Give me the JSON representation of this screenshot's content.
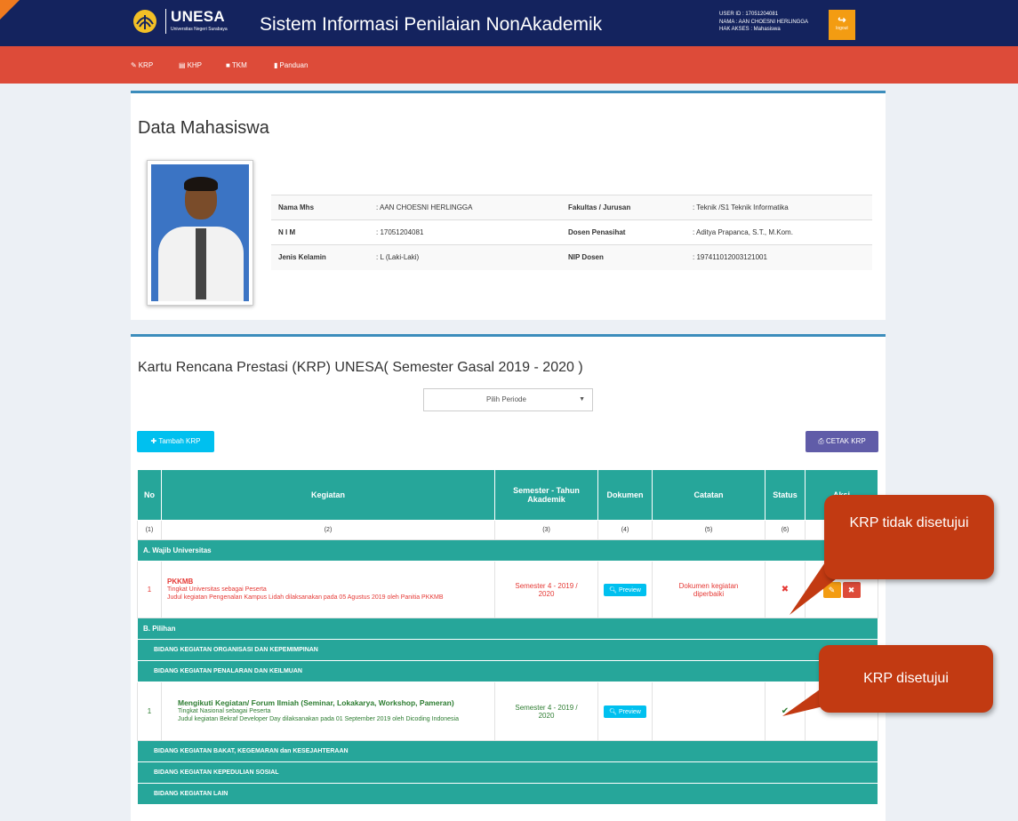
{
  "header": {
    "logo_text": "UNESA",
    "logo_subtext": "Universitas Negeri Surabaya",
    "app_title": "Sistem Informasi Penilaian NonAkademik",
    "user_id": "USER ID : 17051204081",
    "user_name": "NAMA : AAN CHOESNI HERLINGGA",
    "user_access": "HAK AKSES : Mahasiswa",
    "logout_label": "logout"
  },
  "nav": {
    "items": [
      {
        "label": "KRP",
        "icon": "edit-icon"
      },
      {
        "label": "KHP",
        "icon": "file-icon"
      },
      {
        "label": "TKM",
        "icon": "file-text-icon"
      },
      {
        "label": "Panduan",
        "icon": "book-icon"
      }
    ]
  },
  "student": {
    "section_title": "Data Mahasiswa",
    "fields": [
      {
        "label": "Nama Mhs",
        "value": ": AAN CHOESNI HERLINGGA",
        "label2": "Fakultas / Jurusan",
        "value2": ": Teknik /S1 Teknik Informatika"
      },
      {
        "label": "N I M",
        "value": ": 17051204081",
        "label2": "Dosen Penasihat",
        "value2": ": Aditya Prapanca, S.T., M.Kom."
      },
      {
        "label": "Jenis Kelamin",
        "value": ": L (Laki-Laki)",
        "label2": "NIP Dosen",
        "value2": ": 197411012003121001"
      }
    ]
  },
  "krp": {
    "title": "Kartu Rencana Prestasi (KRP) UNESA( Semester Gasal 2019 - 2020 )",
    "periode_placeholder": "Pilih Periode",
    "add_label": "Tambah KRP",
    "print_label": "CETAK KRP",
    "columns": [
      "No",
      "Kegiatan",
      "Semester - Tahun Akademik",
      "Dokumen",
      "Catatan",
      "Status",
      "Aksi"
    ],
    "column_numbers": [
      "(1)",
      "(2)",
      "(3)",
      "(4)",
      "(5)",
      "(6)",
      ""
    ],
    "group_a": "A. Wajib Universitas",
    "row1": {
      "no": "1",
      "title": "PKKMB",
      "level": "Tingkat Universitas sebagai Peserta",
      "desc": "Judul kegiatan Pengenalan Kampus Lidah dilaksanakan pada 05 Agustus 2019 oleh Panitia PKKMB",
      "semester": "Semester 4 - 2019 / 2020",
      "doc_button": "Preview",
      "note": "Dokumen kegiatan diperbaiki",
      "status": "✖"
    },
    "group_b": "B. Pilihan",
    "sub1": "BIDANG KEGIATAN ORGANISASI DAN KEPEMIMPINAN",
    "sub2": "BIDANG KEGIATAN PENALARAN DAN KEILMUAN",
    "row2": {
      "no": "1",
      "title": "Mengikuti Kegiatan/ Forum Ilmiah (Seminar, Lokakarya, Workshop, Pameran)",
      "level": "Tingkat Nasional sebagai Peserta",
      "desc": "Judul kegiatan Bekraf Developer Day dilaksanakan pada 01 September 2019 oleh Dicoding Indonesia",
      "semester": "Semester 4 - 2019 / 2020",
      "doc_button": "Preview",
      "note": "",
      "status": "✔"
    },
    "sub3": "BIDANG KEGIATAN BAKAT, KEGEMARAN dan KESEJAHTERAAN",
    "sub4": "BIDANG KEGIATAN KEPEDULIAN SOSIAL",
    "sub5": "BIDANG KEGIATAN LAIN"
  },
  "callouts": {
    "rejected": "KRP tidak disetujui",
    "approved": "KRP disetujui"
  },
  "colors": {
    "header": "#14235e",
    "navbar": "#dd4b39",
    "table": "#26a69a",
    "callout": "#c23a12"
  }
}
